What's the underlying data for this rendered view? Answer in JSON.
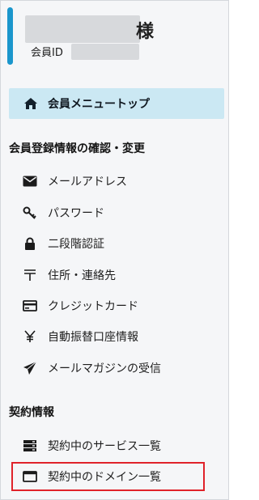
{
  "user": {
    "honorific": "様",
    "member_id_label": "会員ID"
  },
  "menu_top": {
    "label": "会員メニュートップ",
    "icon": "home-icon"
  },
  "sections": [
    {
      "title": "会員登録情報の確認・変更",
      "items": [
        {
          "label": "メールアドレス",
          "icon": "envelope-icon"
        },
        {
          "label": "パスワード",
          "icon": "key-icon"
        },
        {
          "label": "二段階認証",
          "icon": "lock-icon"
        },
        {
          "label": "住所・連絡先",
          "icon": "postal-mark-icon"
        },
        {
          "label": "クレジットカード",
          "icon": "credit-card-icon"
        },
        {
          "label": "自動振替口座情報",
          "icon": "yen-icon"
        },
        {
          "label": "メールマガジンの受信",
          "icon": "paper-plane-icon"
        }
      ]
    },
    {
      "title": "契約情報",
      "items": [
        {
          "label": "契約中のサービス一覧",
          "icon": "server-icon"
        },
        {
          "label": "契約中のドメイン一覧",
          "icon": "window-icon",
          "highlighted": true
        }
      ]
    }
  ],
  "colors": {
    "accent": "#1a96cc",
    "active_bg": "#cbe8f3",
    "highlight_border": "#e0222a",
    "panel_bg": "#f5f6f8"
  }
}
